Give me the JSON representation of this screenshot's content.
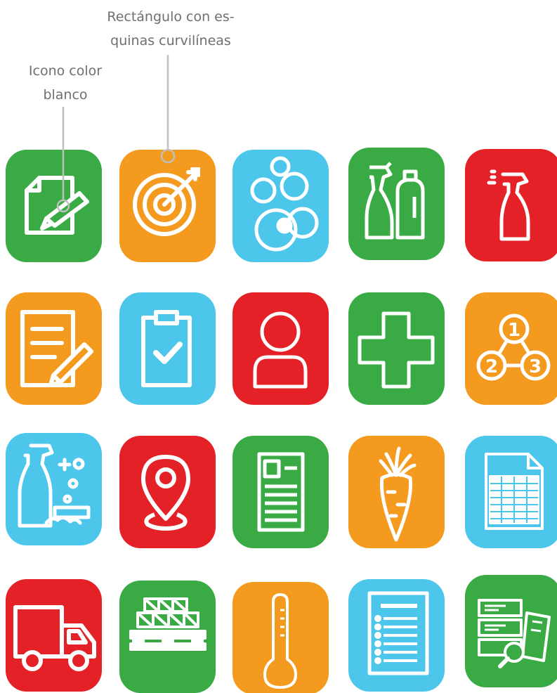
{
  "annotations": {
    "rounded_rect_label": "Rectángulo con es-\nquinas curvilíneas",
    "icon_color_label": "Icono color\nblanco"
  },
  "colors": {
    "green": "#3aaa45",
    "orange": "#f39a1f",
    "blue": "#4cc6ea",
    "red": "#e52128",
    "icon_stroke": "#ffffff",
    "annotation_text": "#6f6f6f",
    "leader_line": "#c0c0c0"
  },
  "icons": [
    {
      "name": "document-edit-icon",
      "color": "green"
    },
    {
      "name": "target-icon",
      "color": "orange"
    },
    {
      "name": "bubbles-icon",
      "color": "blue"
    },
    {
      "name": "cleaning-bottles-icon",
      "color": "green"
    },
    {
      "name": "spray-bottle-icon",
      "color": "red"
    },
    {
      "name": "document-pencil-icon",
      "color": "orange"
    },
    {
      "name": "clipboard-check-icon",
      "color": "blue"
    },
    {
      "name": "person-icon",
      "color": "red"
    },
    {
      "name": "medical-cross-icon",
      "color": "green"
    },
    {
      "name": "numbered-steps-icon",
      "color": "orange"
    },
    {
      "name": "cleaning-products-icon",
      "color": "blue"
    },
    {
      "name": "location-pin-icon",
      "color": "red"
    },
    {
      "name": "id-document-icon",
      "color": "green"
    },
    {
      "name": "carrot-icon",
      "color": "orange"
    },
    {
      "name": "spreadsheet-file-icon",
      "color": "blue"
    },
    {
      "name": "delivery-truck-icon",
      "color": "red"
    },
    {
      "name": "boxes-pallet-icon",
      "color": "green"
    },
    {
      "name": "thermometer-icon",
      "color": "orange"
    },
    {
      "name": "checklist-document-icon",
      "color": "blue"
    },
    {
      "name": "search-documents-icon",
      "color": "green"
    }
  ]
}
